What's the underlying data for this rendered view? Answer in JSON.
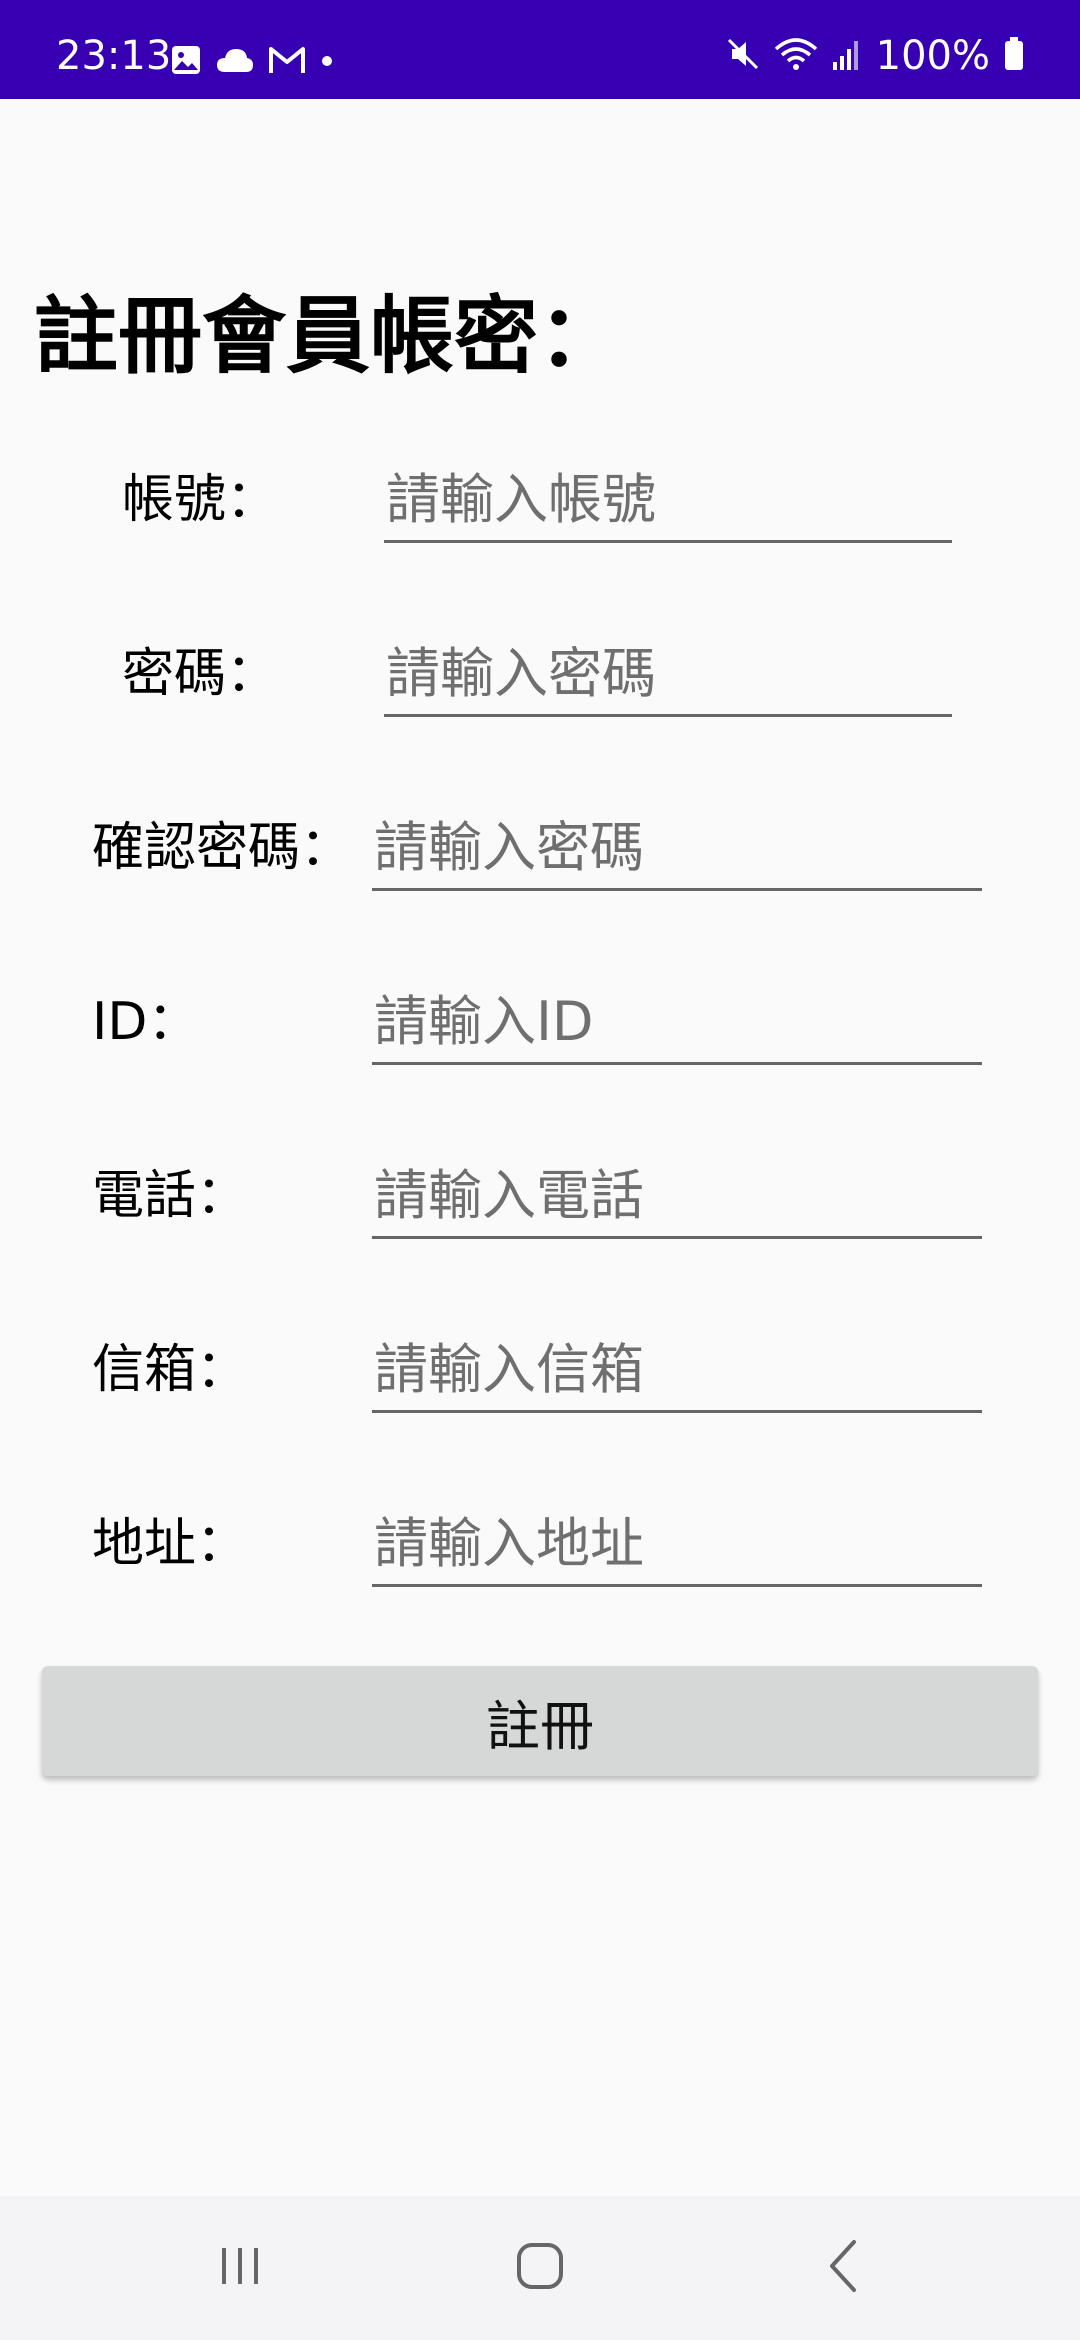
{
  "status_bar": {
    "time": "23:13",
    "battery": "100%",
    "background": "#3700b3",
    "icons": [
      "gallery-icon",
      "cloud-icon",
      "gmail-icon",
      "dot-icon",
      "mute-icon",
      "wifi-icon",
      "signal-icon",
      "battery-icon"
    ]
  },
  "form": {
    "title": "註冊會員帳密：",
    "rows": [
      {
        "label": "帳號：",
        "placeholder": "請輸入帳號"
      },
      {
        "label": "密碼：",
        "placeholder": "請輸入密碼"
      },
      {
        "label": "確認密碼：",
        "placeholder": "請輸入密碼"
      },
      {
        "label": "ID：",
        "placeholder": "請輸入ID"
      },
      {
        "label": "電話：",
        "placeholder": "請輸入電話"
      },
      {
        "label": "信箱：",
        "placeholder": "請輸入信箱"
      },
      {
        "label": "地址：",
        "placeholder": "請輸入地址"
      }
    ],
    "submit_label": "註冊"
  },
  "nav_bar": {
    "icons": [
      "recent-apps-icon",
      "home-icon",
      "back-icon"
    ]
  }
}
